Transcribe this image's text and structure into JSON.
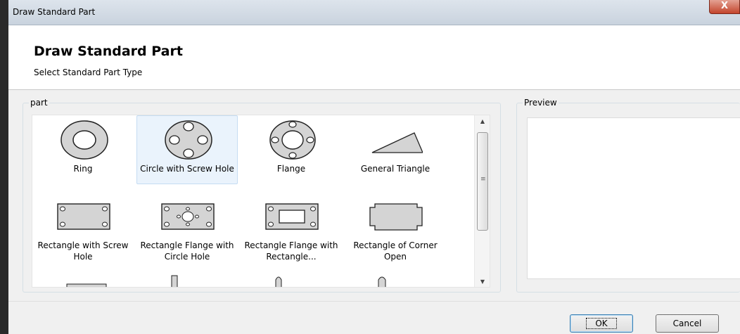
{
  "window": {
    "title": "Draw Standard Part",
    "close_label": "X"
  },
  "header": {
    "title": "Draw Standard Part",
    "subtitle": "Select Standard Part Type"
  },
  "groups": {
    "part_label": "part",
    "preview_label": "Preview"
  },
  "parts": [
    {
      "label": "Ring",
      "icon": "ring-icon",
      "selected": false
    },
    {
      "label": "Circle with Screw Hole",
      "icon": "circle-screw-hole-icon",
      "selected": true
    },
    {
      "label": "Flange",
      "icon": "flange-icon",
      "selected": false
    },
    {
      "label": "General Triangle",
      "icon": "triangle-icon",
      "selected": false
    },
    {
      "label": "Rectangle with Screw Hole",
      "icon": "rect-screw-hole-icon",
      "selected": false
    },
    {
      "label": "Rectangle Flange with Circle Hole",
      "icon": "rect-flange-circle-icon",
      "selected": false
    },
    {
      "label": "Rectangle Flange with Rectangle...",
      "icon": "rect-flange-rect-icon",
      "selected": false
    },
    {
      "label": "Rectangle of Corner Open",
      "icon": "rect-corner-open-icon",
      "selected": false
    }
  ],
  "buttons": {
    "ok": "OK",
    "cancel": "Cancel"
  },
  "colors": {
    "shape_fill": "#d4d4d4",
    "selection": "#eaf3fc",
    "close": "#c3452c"
  }
}
